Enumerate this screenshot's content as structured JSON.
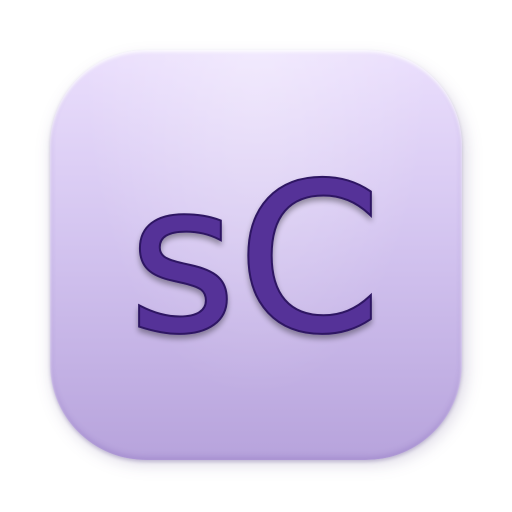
{
  "icon": {
    "label": "sC",
    "colors": {
      "background_top": "#ebdffd",
      "background_bottom": "#b7a3dc",
      "glyph_fill": "#553198",
      "glyph_stroke": "#2e1763"
    }
  }
}
